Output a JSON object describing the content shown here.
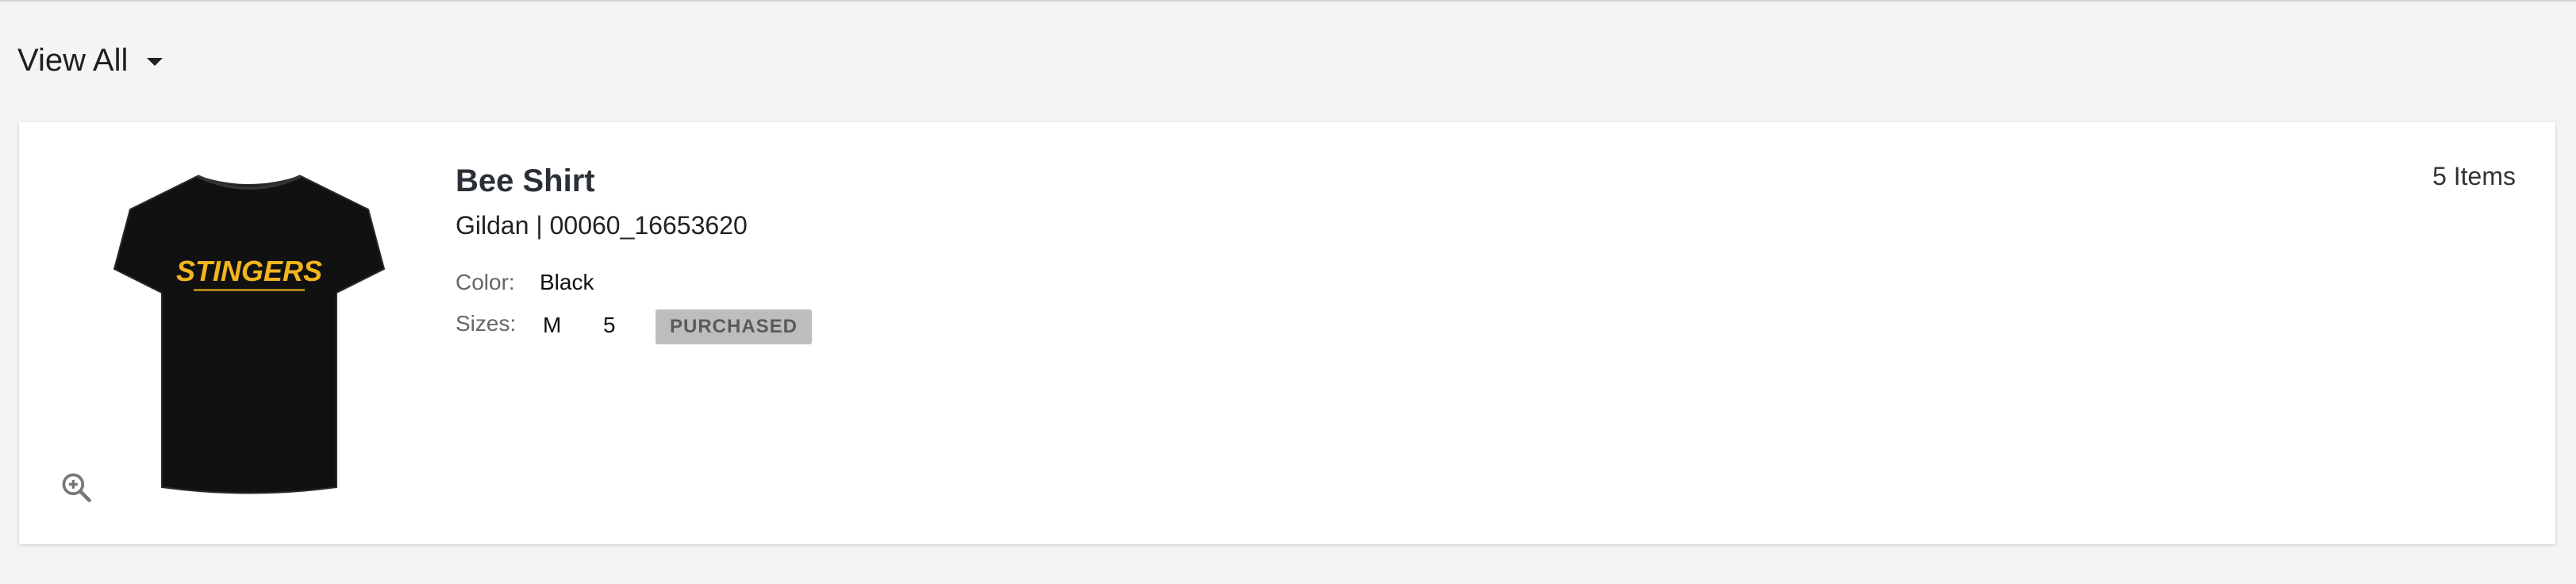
{
  "header": {
    "view_all_label": "View All"
  },
  "product": {
    "name": "Bee Shirt",
    "brand_sku": "Gildan | 00060_16653620",
    "color_label": "Color:",
    "color_value": "Black",
    "sizes_label": "Sizes:",
    "size": "M",
    "size_qty": "5",
    "status_badge": "PURCHASED",
    "items_count": "5 Items",
    "image_logo_text": "STINGERS",
    "shirt_color": "#111111",
    "logo_color": "#f2b51d"
  },
  "icons": {
    "dropdown": "chevron-down-icon",
    "zoom": "zoom-in-icon"
  }
}
